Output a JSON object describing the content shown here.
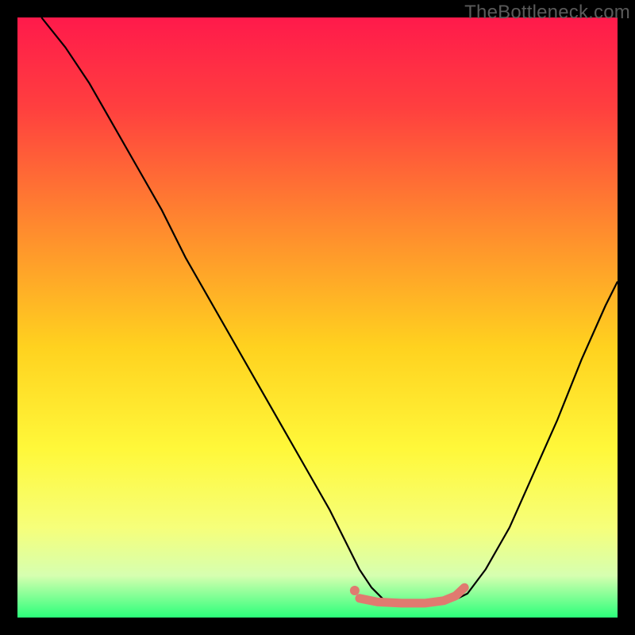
{
  "watermark": "TheBottleneck.com",
  "chart_data": {
    "type": "line",
    "title": "",
    "xlabel": "",
    "ylabel": "",
    "xlim": [
      0,
      100
    ],
    "ylim": [
      0,
      100
    ],
    "grid": false,
    "legend": false,
    "background_gradient": {
      "stops": [
        {
          "offset": 0.0,
          "color": "#ff1a4b"
        },
        {
          "offset": 0.15,
          "color": "#ff3f3f"
        },
        {
          "offset": 0.35,
          "color": "#ff8a2e"
        },
        {
          "offset": 0.55,
          "color": "#ffd21f"
        },
        {
          "offset": 0.72,
          "color": "#fff83a"
        },
        {
          "offset": 0.85,
          "color": "#f6ff7a"
        },
        {
          "offset": 0.93,
          "color": "#d6ffb0"
        },
        {
          "offset": 1.0,
          "color": "#2bff7a"
        }
      ]
    },
    "series": [
      {
        "name": "bottleneck-curve",
        "stroke": "#000000",
        "stroke_width": 2.2,
        "x": [
          4,
          8,
          12,
          16,
          20,
          24,
          28,
          32,
          36,
          40,
          44,
          48,
          52,
          55,
          57,
          59,
          61,
          65,
          69,
          73,
          75,
          78,
          82,
          86,
          90,
          94,
          98,
          100
        ],
        "y": [
          100,
          95,
          89,
          82,
          75,
          68,
          60,
          53,
          46,
          39,
          32,
          25,
          18,
          12,
          8,
          5,
          3,
          2,
          2,
          3,
          4,
          8,
          15,
          24,
          33,
          43,
          52,
          56
        ]
      },
      {
        "name": "highlight-segment",
        "stroke": "#e07a70",
        "stroke_width": 11,
        "linecap": "round",
        "x": [
          57,
          60,
          64,
          68,
          71,
          73,
          74.5
        ],
        "y": [
          3.2,
          2.6,
          2.4,
          2.4,
          2.8,
          3.6,
          5.0
        ]
      },
      {
        "name": "highlight-dot",
        "type": "scatter",
        "fill": "#e07a70",
        "radius": 6,
        "x": [
          56.2
        ],
        "y": [
          4.5
        ]
      }
    ]
  }
}
